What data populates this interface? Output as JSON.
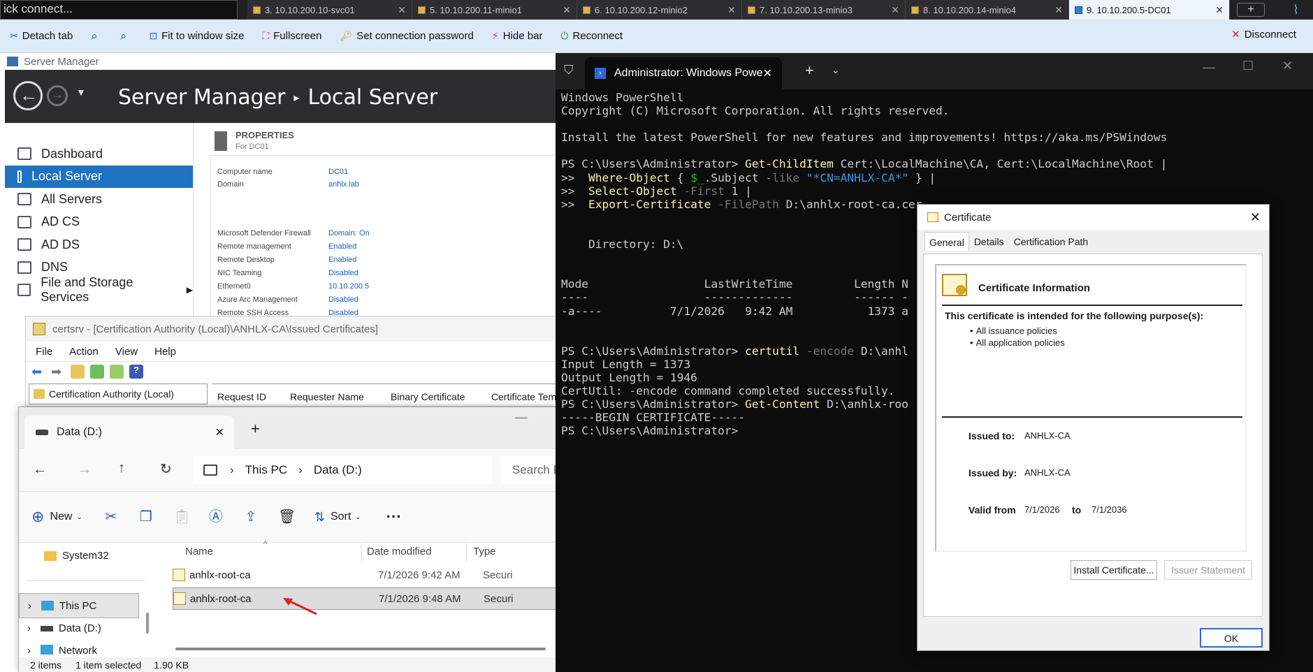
{
  "topbar": {
    "quick_connect": "ick connect...",
    "tabs": [
      {
        "label": "3. 10.10.200.10-svc01"
      },
      {
        "label": "5. 10.10.200.11-minio1"
      },
      {
        "label": "6. 10.10.200.12-minio2"
      },
      {
        "label": "7. 10.10.200.13-minio3"
      },
      {
        "label": "8. 10.10.200.14-minio4"
      },
      {
        "label": "9. 10.10.200.5-DC01"
      }
    ],
    "new_tab": "+"
  },
  "toolbar": {
    "detach": "Detach tab",
    "fit": "Fit to window size",
    "fullscreen": "Fullscreen",
    "set_password": "Set connection password",
    "hide_bar": "Hide bar",
    "reconnect": "Reconnect",
    "disconnect": "Disconnect"
  },
  "server_manager": {
    "window_title": "Server Manager",
    "crumb_app": "Server Manager",
    "crumb_sep": "▸",
    "crumb_page": "Local Server",
    "sidebar": [
      {
        "label": "Dashboard"
      },
      {
        "label": "Local Server"
      },
      {
        "label": "All Servers"
      },
      {
        "label": "AD CS"
      },
      {
        "label": "AD DS"
      },
      {
        "label": "DNS"
      },
      {
        "label": "File and Storage Services"
      }
    ],
    "properties_title": "PROPERTIES",
    "properties_sub": "For DC01",
    "props": [
      {
        "k": "Computer name",
        "v": "DC01"
      },
      {
        "k": "Domain",
        "v": "anhlx.lab"
      },
      {
        "k": "Microsoft Defender Firewall",
        "v": "Domain: On"
      },
      {
        "k": "Remote management",
        "v": "Enabled"
      },
      {
        "k": "Remote Desktop",
        "v": "Enabled"
      },
      {
        "k": "NIC Teaming",
        "v": "Disabled"
      },
      {
        "k": "Ethernet0",
        "v": "10.10.200.5"
      },
      {
        "k": "Azure Arc Management",
        "v": "Disabled"
      },
      {
        "k": "Remote SSH Access",
        "v": "Disabled"
      }
    ]
  },
  "certsrv": {
    "title": "certsrv - [Certification Authority (Local)\\ANHLX-CA\\Issued Certificates]",
    "menu": [
      "File",
      "Action",
      "View",
      "Help"
    ],
    "tree_root": "Certification Authority (Local)",
    "columns": [
      "Request ID",
      "Requester Name",
      "Binary Certificate",
      "Certificate Tem"
    ]
  },
  "explorer": {
    "tab_title": "Data (D:)",
    "new_tab": "+",
    "path": [
      "This PC",
      "Data (D:)"
    ],
    "search_placeholder": "Search D",
    "cmd_new": "New",
    "cmd_sort": "Sort",
    "col_name": "Name",
    "col_date": "Date modified",
    "col_type": "Type",
    "nav": [
      {
        "label": "System32"
      },
      {
        "label": "This PC"
      },
      {
        "label": "Data (D:)"
      },
      {
        "label": "Network"
      }
    ],
    "files": [
      {
        "name": "anhlx-root-ca",
        "date": "7/1/2026 9:42 AM",
        "type": "Securi"
      },
      {
        "name": "anhlx-root-ca",
        "date": "7/1/2026 9:48 AM",
        "type": "Securi"
      }
    ],
    "status_items": "2 items",
    "status_selected": "1 item selected",
    "status_size": "1.90 KB"
  },
  "powershell": {
    "tab_title": "Administrator: Windows Powe",
    "lines": {
      "l1": "Windows PowerShell",
      "l2": "Copyright (C) Microsoft Corporation. All rights reserved.",
      "l3": "Install the latest PowerShell for new features and improvements! https://aka.ms/PSWindows",
      "p1": "PS C:\\Users\\Administrator> ",
      "c1": "Get-ChildItem",
      "a1": " Cert:\\LocalMachine\\CA, Cert:\\LocalMachine\\Root |",
      "cont": ">>  ",
      "c2": "Where-Object",
      "a2a": " { ",
      "a2b": "$_",
      "a2c": ".Subject ",
      "a2d": "-like",
      "a2e": " \"*CN=ANHLX-CA*\"",
      "a2f": " } |",
      "c3": "Select-Object",
      "a3a": " -First",
      "a3b": " 1 |",
      "c4": "Export-Certificate",
      "a4a": " -FilePath",
      "a4b": " D:\\anhlx-root-ca.cer",
      "dir": "    Directory: D:\\",
      "hdr": "Mode                 LastWriteTime         Length N",
      "sep": "----                 -------------         ------ -",
      "row": "-a----          7/1/2026   9:42 AM           1373 a",
      "p2": "PS C:\\Users\\Administrator> ",
      "c5": "certutil",
      "a5a": " -encode",
      "a5b": " D:\\anhl",
      "o1": "Input Length = 1373",
      "o2": "Output Length = 1946",
      "o3": "CertUtil: -encode command completed successfully.",
      "p3": "PS C:\\Users\\Administrator> ",
      "c6": "Get-Content",
      "a6": " D:\\anhlx-roo",
      "o4": "-----BEGIN CERTIFICATE-----",
      "p4": "PS C:\\Users\\Administrator>"
    }
  },
  "certificate": {
    "title": "Certificate",
    "tabs": [
      "General",
      "Details",
      "Certification Path"
    ],
    "info_title": "Certificate Information",
    "purpose_head": "This certificate is intended for the following purpose(s):",
    "purposes": [
      "All issuance policies",
      "All application policies"
    ],
    "issued_to_label": "Issued to:",
    "issued_to": "ANHLX-CA",
    "issued_by_label": "Issued by:",
    "issued_by": "ANHLX-CA",
    "valid_from_label": "Valid from",
    "valid_from": "7/1/2026",
    "valid_to_label": "to",
    "valid_to": "7/1/2036",
    "install_btn": "Install Certificate...",
    "issuer_btn": "Issuer Statement",
    "ok_btn": "OK"
  }
}
